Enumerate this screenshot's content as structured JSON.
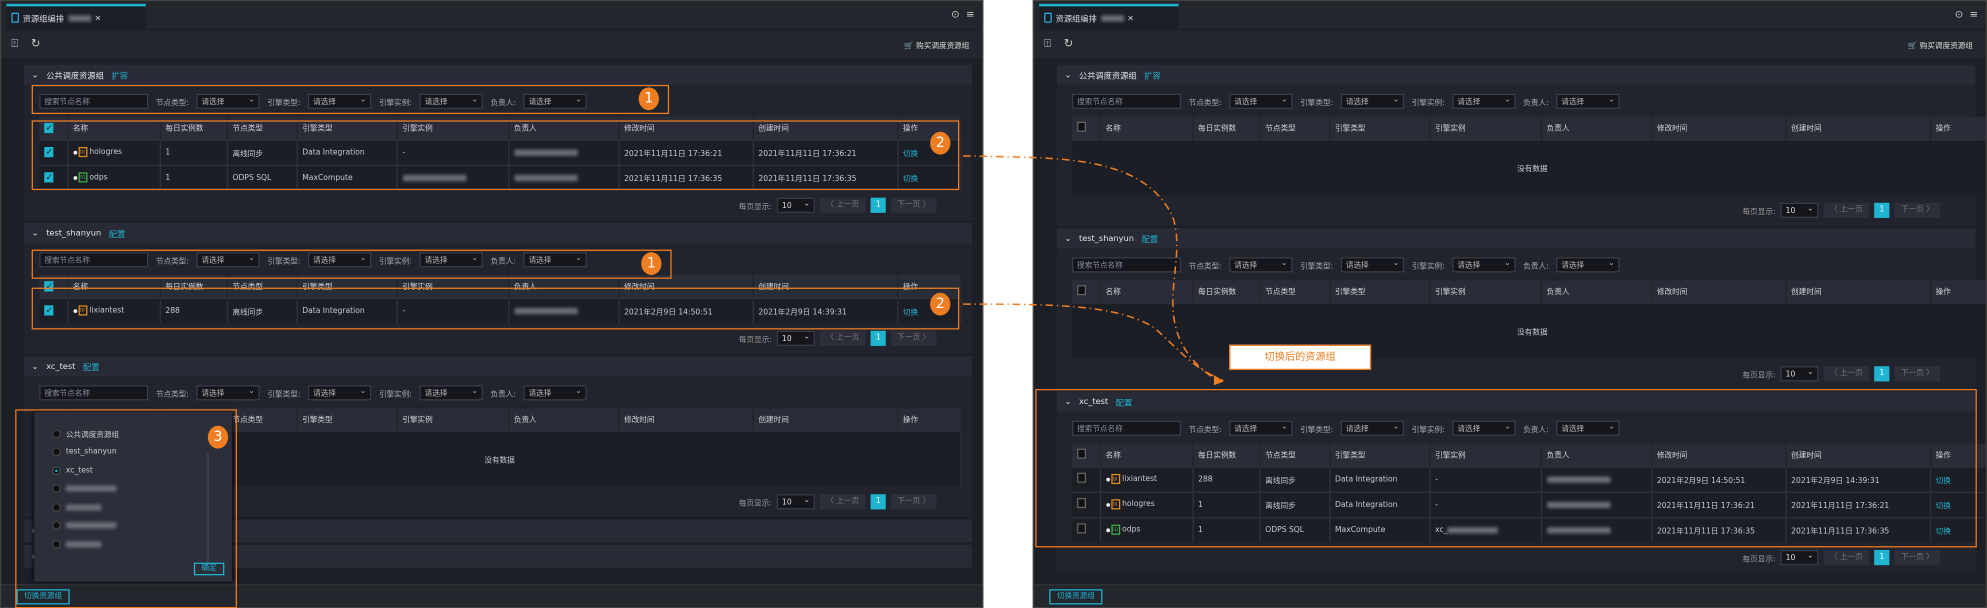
{
  "tab": {
    "title": "资源组编排",
    "close": "×"
  },
  "toolbar": {
    "buy_label": "购买调度资源组"
  },
  "filters": {
    "search_placeholder": "搜索节点名称",
    "node_type": "节点类型:",
    "engine_type": "引擎类型:",
    "engine_instance": "引擎实例:",
    "owner": "负责人:",
    "select_placeholder": "请选择"
  },
  "columns": [
    "名称",
    "每日实例数",
    "节点类型",
    "引擎类型",
    "引擎实例",
    "负责人",
    "修改时间",
    "创建时间",
    "操作"
  ],
  "pagination": {
    "per_page_label": "每页显示:",
    "per_page": "10",
    "prev": "〈 上一页",
    "page": "1",
    "next": "下一页 〉"
  },
  "empty_text": "没有数据",
  "switch_button": "切换资源组",
  "accent_color": "#1fb5d1",
  "annotation_color": "#ef7d22",
  "left": {
    "sections": [
      {
        "title": "公共调度资源组",
        "link": "扩容",
        "header_checked": true,
        "rows": [
          {
            "checked": true,
            "icon": "DI",
            "name": "hologres",
            "daily": "1",
            "node_type": "离线同步",
            "engine_type": "Data Integration",
            "engine_instance": "-",
            "modified": "2021年11月11日 17:36:21",
            "created": "2021年11月11日 17:36:21",
            "action": "切换"
          },
          {
            "checked": true,
            "icon": "SQ",
            "name": "odps",
            "daily": "1",
            "node_type": "ODPS SQL",
            "engine_type": "MaxCompute",
            "engine_instance": "",
            "modified": "2021年11月11日 17:36:35",
            "created": "2021年11月11日 17:36:35",
            "action": "切换"
          }
        ]
      },
      {
        "title": "test_shanyun",
        "link": "配置",
        "header_checked": true,
        "rows": [
          {
            "checked": true,
            "icon": "DI",
            "name": "lixiantest",
            "daily": "288",
            "node_type": "离线同步",
            "engine_type": "Data Integration",
            "engine_instance": "-",
            "modified": "2021年2月9日 14:50:51",
            "created": "2021年2月9日 14:39:31",
            "action": "切换"
          }
        ]
      },
      {
        "title": "xc_test",
        "link": "配置",
        "header_checked": false,
        "rows": []
      }
    ],
    "collapsed_count": 2,
    "popup": {
      "options": [
        {
          "label": "公共调度资源组",
          "selected": false
        },
        {
          "label": "test_shanyun",
          "selected": false
        },
        {
          "label": "xc_test",
          "selected": true
        },
        {
          "label": "",
          "selected": false
        },
        {
          "label": "",
          "selected": false
        },
        {
          "label": "",
          "selected": false
        },
        {
          "label": "",
          "selected": false
        }
      ],
      "confirm": "确定"
    },
    "annotations": [
      "1",
      "2",
      "1",
      "2",
      "3"
    ]
  },
  "right": {
    "sections": [
      {
        "title": "公共调度资源组",
        "link": "扩容",
        "header_checked": false,
        "rows": []
      },
      {
        "title": "test_shanyun",
        "link": "配置",
        "header_checked": false,
        "rows": []
      },
      {
        "title": "xc_test",
        "link": "配置",
        "header_checked": false,
        "rows": [
          {
            "checked": false,
            "icon": "DI",
            "name": "lixiantest",
            "daily": "288",
            "node_type": "离线同步",
            "engine_type": "Data Integration",
            "engine_instance": "-",
            "modified": "2021年2月9日 14:50:51",
            "created": "2021年2月9日 14:39:31",
            "action": "切换"
          },
          {
            "checked": false,
            "icon": "DI",
            "name": "hologres",
            "daily": "1",
            "node_type": "离线同步",
            "engine_type": "Data Integration",
            "engine_instance": "-",
            "modified": "2021年11月11日 17:36:21",
            "created": "2021年11月11日 17:36:21",
            "action": "切换"
          },
          {
            "checked": false,
            "icon": "SQ",
            "name": "odps",
            "daily": "1",
            "node_type": "ODPS SQL",
            "engine_type": "MaxCompute",
            "engine_instance": "xc_",
            "modified": "2021年11月11日 17:36:35",
            "created": "2021年11月11日 17:36:35",
            "action": "切换"
          }
        ]
      }
    ],
    "callout": "切换后的资源组"
  }
}
